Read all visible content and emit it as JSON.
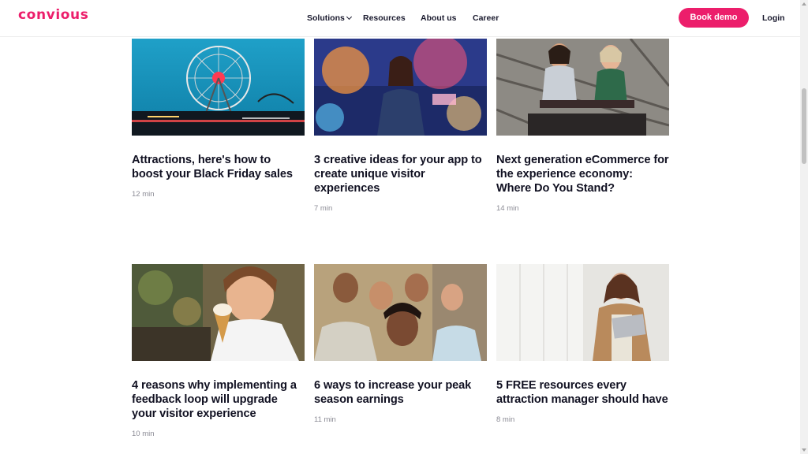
{
  "brand": {
    "logo_text": "convious",
    "accent": "#ec1e6b"
  },
  "nav": {
    "items": [
      "Solutions",
      "Resources",
      "About us",
      "Career"
    ],
    "book_demo": "Book demo",
    "login": "Login"
  },
  "articles": [
    {
      "title": "Attractions, here's how to boost your Black Friday sales",
      "read_time": "12 min",
      "image": "ferris-wheel-night-photo"
    },
    {
      "title": "3 creative ideas for your app to create unique visitor experiences",
      "read_time": "7 min",
      "image": "woman-carnival-ride-photo"
    },
    {
      "title": "Next generation eCommerce for the experience economy: Where Do You Stand?",
      "read_time": "14 min",
      "image": "roller-coaster-riders-photo"
    },
    {
      "title": "4 reasons why implementing a feedback loop will upgrade your visitor experience",
      "read_time": "10 min",
      "image": "girl-ice-cream-photo"
    },
    {
      "title": "6 ways to increase your peak season earnings",
      "read_time": "11 min",
      "image": "group-selfie-photo"
    },
    {
      "title": "5 FREE resources every attraction manager should have",
      "read_time": "8 min",
      "image": "woman-laptop-photo"
    }
  ]
}
